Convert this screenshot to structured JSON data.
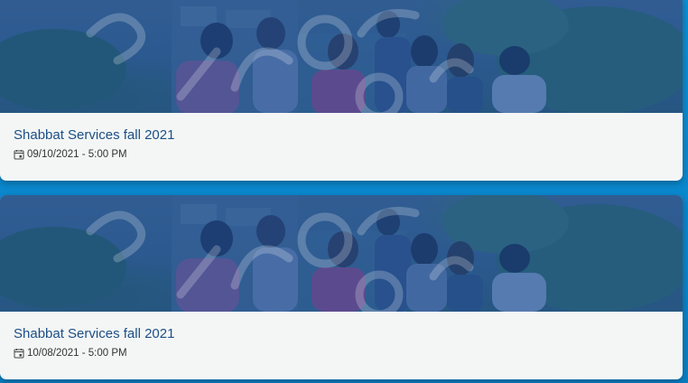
{
  "events": [
    {
      "title": "Shabbat Services fall 2021",
      "date": "09/10/2021 - 5:00 PM",
      "date_icon": "calendar-icon"
    },
    {
      "title": "Shabbat Services fall 2021",
      "date": "10/08/2021 - 5:00 PM",
      "date_icon": "calendar-icon"
    }
  ],
  "colors": {
    "page_background": "#0b8fd3",
    "card_background": "#f4f6f5",
    "title_color": "#1c4f86",
    "image_tint": "#1252aa"
  }
}
